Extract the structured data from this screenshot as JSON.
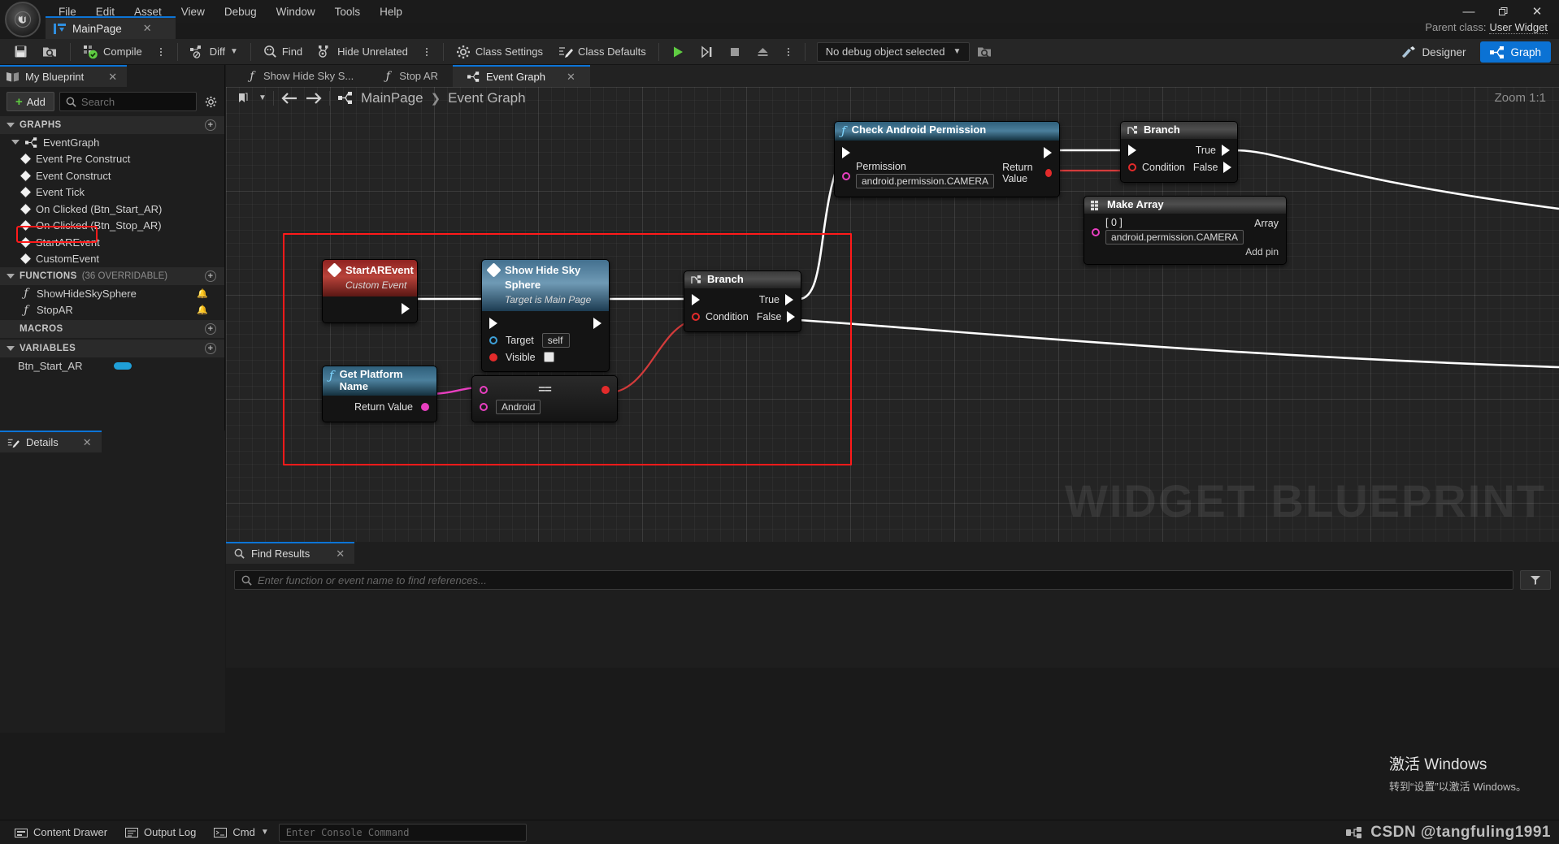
{
  "window": {
    "logo_text": "U",
    "menus": [
      "File",
      "Edit",
      "Asset",
      "View",
      "Debug",
      "Window",
      "Tools",
      "Help"
    ],
    "controls": {
      "minimize": "—",
      "maximize": "❐",
      "close": "✕"
    },
    "asset_tab": {
      "label": "MainPage",
      "close": "✕",
      "icon": "widget-blueprint-icon"
    },
    "parent_class_label": "Parent class:",
    "parent_class_value": "User Widget"
  },
  "toolbar": {
    "save_tooltip": "Save",
    "browse_tooltip": "Browse",
    "compile_label": "Compile",
    "diff_label": "Diff",
    "find_label": "Find",
    "hide_unrelated_label": "Hide Unrelated",
    "class_settings_label": "Class Settings",
    "class_defaults_label": "Class Defaults",
    "debug_object_label": "No debug object selected",
    "designer_label": "Designer",
    "graph_label": "Graph",
    "accent_blue": "#0b72d4"
  },
  "my_blueprint": {
    "tab_label": "My Blueprint",
    "tab_close": "✕",
    "add_label": "Add",
    "search_placeholder": "Search",
    "sections": {
      "graphs": {
        "label": "GRAPHS"
      },
      "functions": {
        "label": "FUNCTIONS",
        "count": "(36 OVERRIDABLE)"
      },
      "macros": {
        "label": "MACROS"
      },
      "variables": {
        "label": "VARIABLES"
      }
    },
    "event_graph_label": "EventGraph",
    "events": [
      "Event Pre Construct",
      "Event Construct",
      "Event Tick",
      "On Clicked (Btn_Start_AR)",
      "On Clicked (Btn_Stop_AR)",
      "StartAREvent",
      "CustomEvent"
    ],
    "highlighted_event": "StartAREvent",
    "functions": [
      "ShowHideSkySphere",
      "StopAR"
    ],
    "variables": [
      "Btn_Start_AR"
    ]
  },
  "details": {
    "tab_label": "Details",
    "tab_close": "✕"
  },
  "graph_tabs": [
    {
      "label": "Show Hide Sky S...",
      "icon": "function-icon",
      "active": false
    },
    {
      "label": "Stop AR",
      "icon": "function-icon",
      "active": false
    },
    {
      "label": "Event Graph",
      "icon": "graph-icon",
      "active": true,
      "close": "✕"
    }
  ],
  "breadcrumb": {
    "root": "MainPage",
    "separator": "❯",
    "current": "Event Graph"
  },
  "zoom_label": "Zoom 1:1",
  "canvas": {
    "watermark": "WIDGET BLUEPRINT",
    "nodes": {
      "start_ar_event": {
        "title": "StartAREvent",
        "subtitle": "Custom Event"
      },
      "show_hide_sky_sphere": {
        "title": "Show Hide Sky Sphere",
        "subtitle": "Target is Main Page",
        "target_label": "Target",
        "target_value": "self",
        "visible_label": "Visible"
      },
      "branch_main": {
        "title": "Branch",
        "true_label": "True",
        "false_label": "False",
        "condition_label": "Condition"
      },
      "get_platform_name": {
        "title": "Get Platform Name",
        "return_label": "Return Value"
      },
      "equal_compare": {
        "symbol": "==",
        "value": "Android"
      },
      "check_android_permission": {
        "title": "Check Android Permission",
        "permission_label": "Permission",
        "permission_value": "android.permission.CAMERA",
        "return_label": "Return Value"
      },
      "branch_right": {
        "title": "Branch",
        "true_label": "True",
        "false_label": "False",
        "condition_label": "Condition"
      },
      "make_array": {
        "title": "Make Array",
        "index_label": "[ 0 ]",
        "index_value": "android.permission.CAMERA",
        "array_label": "Array",
        "add_pin_label": "Add pin"
      }
    }
  },
  "find_results": {
    "tab_label": "Find Results",
    "tab_close": "✕",
    "search_placeholder": "Enter function or event name to find references..."
  },
  "activate_windows": {
    "line1": "激活 Windows",
    "line2": "转到“设置”以激活 Windows。"
  },
  "statusbar": {
    "content_drawer": "Content Drawer",
    "output_log": "Output Log",
    "cmd_label": "Cmd",
    "console_placeholder": "Enter Console Command",
    "watermark": "CSDN @tangfuling1991"
  }
}
